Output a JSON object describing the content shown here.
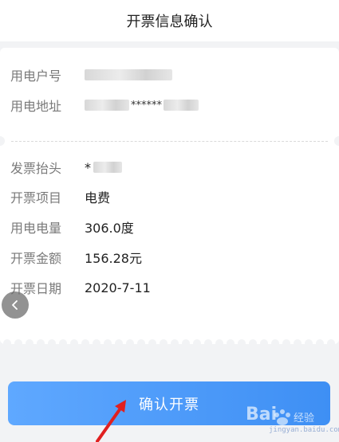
{
  "header": {
    "title": "开票信息确认"
  },
  "account": {
    "fields": [
      {
        "label": "用电户号"
      },
      {
        "label": "用电地址",
        "masked_text": "******"
      }
    ]
  },
  "invoice": {
    "title_label": "发票抬头",
    "title_value_prefix": "*",
    "item_label": "开票项目",
    "item_value": "电费",
    "usage_label": "用电电量",
    "usage_value": "306.0度",
    "amount_label": "开票金额",
    "amount_value": "156.28元",
    "date_label": "开票日期",
    "date_value": "2020-7-11"
  },
  "actions": {
    "confirm_label": "确认开票"
  },
  "watermark": {
    "brand": "Bai",
    "brand_cn": "经验",
    "url": "jingyan.baidu.com"
  },
  "colors": {
    "accent": "#4a97f8",
    "annotation": "#e02020"
  },
  "icons": {
    "back": "chevron-left-icon",
    "arrow": "red-arrow-icon"
  }
}
